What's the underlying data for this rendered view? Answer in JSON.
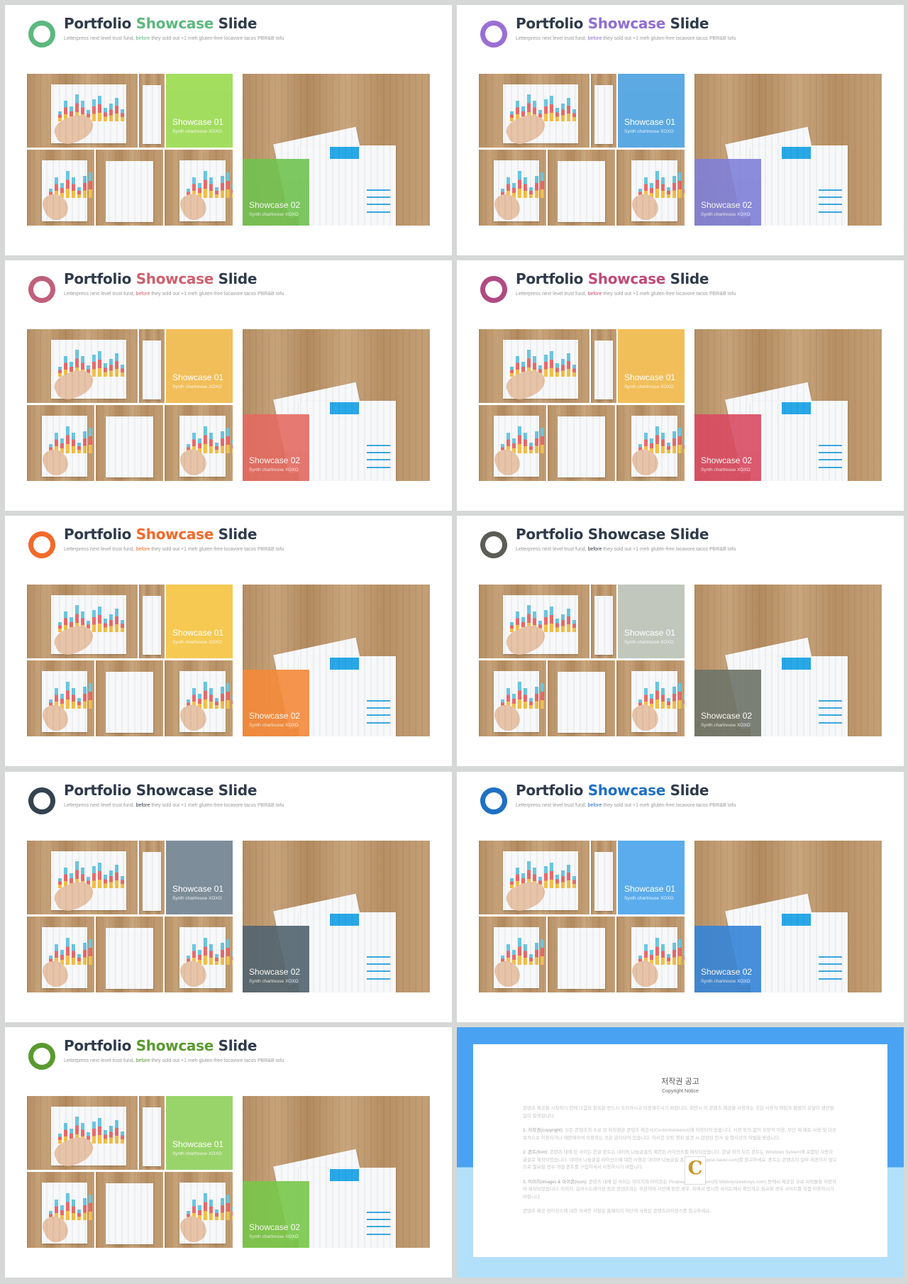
{
  "slide_common": {
    "title_pre": "Portfolio ",
    "title_accent": "Showcase",
    "title_post": " Slide",
    "subtitle_pre": "Letterpress next level trust fund, ",
    "subtitle_accent": "before",
    "subtitle_post": " they sold out +1 meh gluten-free locavore tacos PBR&B tofu",
    "showcase1_title": "Showcase 01",
    "showcase2_title": "Showcase 02",
    "showcase_sub": "Synth chartreuse XOXO"
  },
  "slides": [
    {
      "theme": "green",
      "logo_color": "#5cb87e",
      "accent_color": "#5cb87e",
      "overlay1": "#9ada4e",
      "overlay2": "#70c250"
    },
    {
      "theme": "purple",
      "logo_color": "#9a6fd4",
      "accent_color": "#8f6fd0",
      "overlay1": "#4aa0e0",
      "overlay2": "#7f80d8"
    },
    {
      "theme": "rose",
      "logo_color": "#c0607a",
      "accent_color": "#d0606e",
      "overlay1": "#f0b848",
      "overlay2": "#e36a62"
    },
    {
      "theme": "magenta",
      "logo_color": "#b04a82",
      "accent_color": "#c04a7a",
      "overlay1": "#f0b848",
      "overlay2": "#d84a62"
    },
    {
      "theme": "orange",
      "logo_color": "#f26a2a",
      "accent_color": "#f26a2a",
      "overlay1": "#f5c440",
      "overlay2": "#f58a3a"
    },
    {
      "theme": "gray",
      "logo_color": "#5a5d55",
      "accent_color": "#2f3a4a",
      "overlay1": "#bcc2b8",
      "overlay2": "#6e7468"
    },
    {
      "theme": "navy",
      "logo_color": "#34434f",
      "accent_color": "#2f3a4a",
      "overlay1": "#70818e",
      "overlay2": "#526470"
    },
    {
      "theme": "blue",
      "logo_color": "#1f70c4",
      "accent_color": "#1f70c4",
      "overlay1": "#4aa4ea",
      "overlay2": "#3584d8"
    },
    {
      "theme": "leaf",
      "logo_color": "#5a9a30",
      "accent_color": "#5a9a30",
      "overlay1": "#8fd05a",
      "overlay2": "#78c84a"
    }
  ],
  "notice": {
    "title": "저작권 공고",
    "subtitle": "Copyright Notice",
    "intro": "콘텐츠 제공을 시작하기 전에 다음의 항목을 반드시 숙지하시고 이용해주시기 바랍니다. 위반시 이 콘텐츠 제공을 사용하는 것은 사용자 책임과 불법이 유발이 생성될 일이 발생합니다.",
    "item1_label": "1. 저작권(copyright)",
    "item1_text": ": 모든 콘텐츠의 소유 된 저작권은 콘텐츠 제공사(Contentstokeout)에 저작되어 있습니다. 사전 동의 없이 모방적 이용, 무단 재 배포 사용 및 다른 목적으로 이용하거나 재판매하여 이용하는 것은 금지되어 있습니다. 이러한 모방 행위 발견 시 관련된 민사 및 형사상의 처벌을 받습니다.",
    "item2_label": "2. 폰트(font)",
    "item2_text": ": 콘텐츠 내에 된 사이는 한글 폰트는 네이버 나눔글꼴의 제한된 라이선스를 제작되었습니다. 한글 외의 모든 폰트는 Windows System에 포함된 사용자 글꼴로 제작되었습니다. 네이버 나눔글꼴 라이선스에 대한 사항은 네이버 나눔글꼴 홈페이지(hangeul.naver.com)를 참고하세요. 폰트는 콘텐츠의 일부 제공이지 않으므로 필요할 경우 개별 폰트를 구입하셔서 사용하시기 바랍니다.",
    "item3_label": "3. 이미지(image) & 아이콘(icon)",
    "item3_text": ": 콘텐츠 내에 된 사이는 이미지와 아이콘은 Pixabay(pixabay.com)와 Webolys(webolys.com) 등에서 제공된 무료 저작물을 이용하여 제작되었습니다. 이미지, 일러스트레이션 등은 콘텐츠와는 무관하며 사전에 원한 경우, 위에서 명시한 사이트에서 확인하고 필요할 경우 사이트를 직접 이용하시기 바랍니다.",
    "outro": "콘텐츠 제공 라이선스에 대한 자세한 사항은 홈페이지 하단에 사용된 콘텐츠라이선스를 참고하세요.",
    "watermark": "C"
  }
}
